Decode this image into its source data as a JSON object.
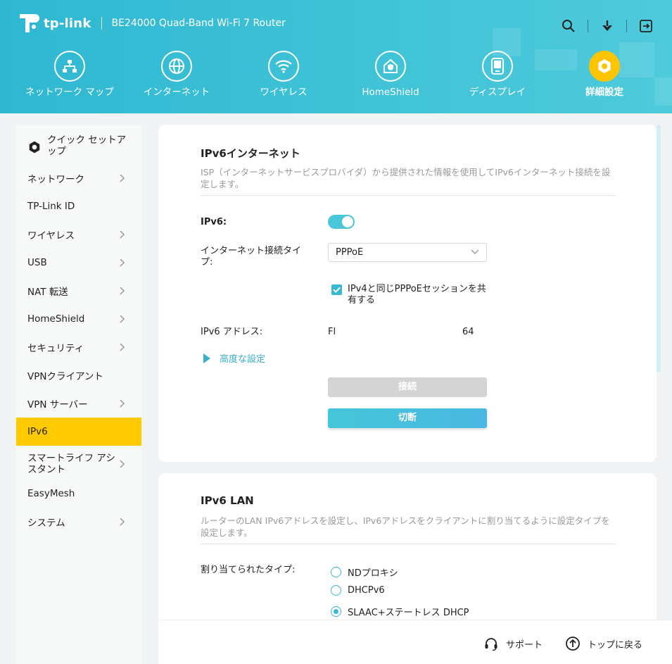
{
  "header": {
    "brand": "tp-link",
    "model": "BE24000 Quad-Band Wi-Fi 7 Router"
  },
  "nav": [
    {
      "label": "ネットワーク マップ",
      "icon": "network-map-icon"
    },
    {
      "label": "インターネット",
      "icon": "globe-icon"
    },
    {
      "label": "ワイヤレス",
      "icon": "wifi-icon"
    },
    {
      "label": "HomeShield",
      "icon": "homeshield-icon"
    },
    {
      "label": "ディスプレイ",
      "icon": "display-icon"
    },
    {
      "label": "詳細設定",
      "icon": "gear-icon",
      "active": true
    }
  ],
  "sidebar": {
    "quick": "クイック セットアップ",
    "items": [
      {
        "label": "ネットワーク",
        "chevron": true
      },
      {
        "label": "TP-Link ID",
        "chevron": false
      },
      {
        "label": "ワイヤレス",
        "chevron": true
      },
      {
        "label": "USB",
        "chevron": true
      },
      {
        "label": "NAT 転送",
        "chevron": true
      },
      {
        "label": "HomeShield",
        "chevron": true
      },
      {
        "label": "セキュリティ",
        "chevron": true
      },
      {
        "label": "VPNクライアント",
        "chevron": false
      },
      {
        "label": "VPN サーバー",
        "chevron": true
      },
      {
        "label": "IPv6",
        "chevron": false,
        "active": true
      },
      {
        "label": "スマートライフ アシスタント",
        "chevron": true
      },
      {
        "label": "EasyMesh",
        "chevron": false
      },
      {
        "label": "システム",
        "chevron": true
      }
    ]
  },
  "ipv6_internet": {
    "title": "IPv6インターネット",
    "desc": "ISP（インターネットサービスプロバイダ）から提供された情報を使用してIPv6インターネット接続を設定します。",
    "ipv6_label": "IPv6:",
    "ipv6_on": true,
    "conn_type_label": "インターネット接続タイプ:",
    "conn_type_value": "PPPoE",
    "share_session_label": "IPv4と同じPPPoEセッションを共有する",
    "share_session_checked": true,
    "addr_label": "IPv6 アドレス:",
    "addr_prefix": "Fl",
    "addr_suffix": "64",
    "advanced": "高度な設定",
    "connect": "接続",
    "disconnect": "切断"
  },
  "ipv6_lan": {
    "title": "IPv6 LAN",
    "desc": "ルーターのLAN IPv6アドレスを設定し、IPv6アドレスをクライアントに割り当てるように設定タイプを設定します。",
    "assign_label": "割り当てられたタイプ:",
    "options": [
      "NDプロキシ",
      "DHCPv6",
      "SLAAC+ステートレス DHCP"
    ],
    "selected": 2
  },
  "footer": {
    "support": "サポート",
    "back_to_top": "トップに戻る"
  },
  "colors": {
    "header": "#3ec2d6",
    "accent": "#ffca00",
    "teal": "#3ab8cf"
  }
}
